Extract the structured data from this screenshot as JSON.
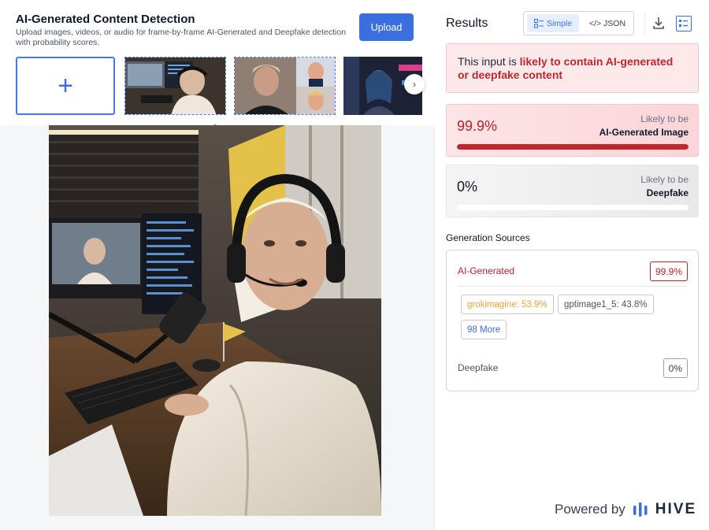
{
  "header": {
    "title": "AI-Generated Content Detection",
    "subtitle": "Upload images, videos, or audio for frame-by-frame AI-Generated and Deepfake detection with probability scores.",
    "upload_label": "Upload"
  },
  "thumbnails": {
    "add_symbol": "+",
    "next_symbol": "›",
    "collapse_symbol": "⌃"
  },
  "results": {
    "title": "Results",
    "view_toggle": {
      "simple_label": "Simple",
      "json_label": "</> JSON",
      "selected": "Simple"
    },
    "verdict": {
      "prefix": "This input is ",
      "highlight": "likely to contain AI-generated or deepfake content"
    },
    "scores": [
      {
        "value_label": "99.9%",
        "value": 0.999,
        "caption_top": "Likely to be",
        "caption_bottom": "AI-Generated Image",
        "color": "#c0262d"
      },
      {
        "value_label": "0%",
        "value": 0.0,
        "caption_top": "Likely to be",
        "caption_bottom": "Deepfake",
        "color": "#9ca3af"
      }
    ],
    "generation_sources": {
      "title": "Generation Sources",
      "ai_label": "AI-Generated",
      "ai_pct": "99.9%",
      "chips": [
        "grokimagine: 53.9%",
        "gptimage1_5: 43.8%"
      ],
      "more_label": "98 More",
      "deepfake_label": "Deepfake",
      "deepfake_pct": "0%"
    }
  },
  "footer": {
    "powered_by": "Powered by",
    "brand": "HIVE"
  },
  "colors": {
    "accent": "#3b6fe0",
    "danger": "#c0262d",
    "warning": "#e9a23b"
  }
}
